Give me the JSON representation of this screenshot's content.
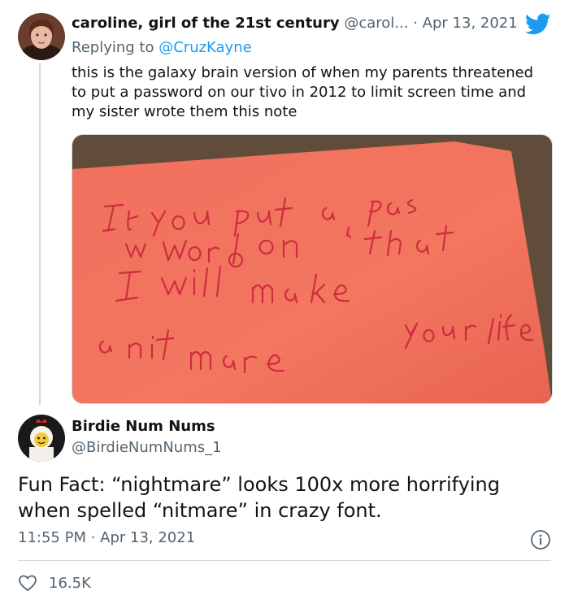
{
  "tweet1": {
    "display_name": "caroline, girl of the 21st century",
    "handle": "@carol...",
    "separator": "·",
    "date": "Apr 13, 2021",
    "replying_to_label": "Replying to",
    "replying_to_handle": "@CruzKayne",
    "text": "this is the galaxy brain version of when my parents threatened to put a password on our tivo in 2012 to limit screen time and my sister wrote them this note",
    "note_lines": [
      "If you Put a pas",
      "w word on that",
      "I will make",
      "your life",
      "a nitmare"
    ]
  },
  "tweet2": {
    "display_name": "Birdie Num Nums",
    "handle": "@BirdieNumNums_1",
    "text": "Fun Fact: “nightmare” looks 100x more horrifying when spelled “nitmare” in crazy font.",
    "timestamp": "11:55 PM · Apr 13, 2021",
    "like_count": "16.5K"
  },
  "colors": {
    "twitter_blue": "#1d9bf0",
    "secondary_text": "#536471",
    "note_paper": "#f2705e",
    "note_ink": "#c8203a"
  }
}
